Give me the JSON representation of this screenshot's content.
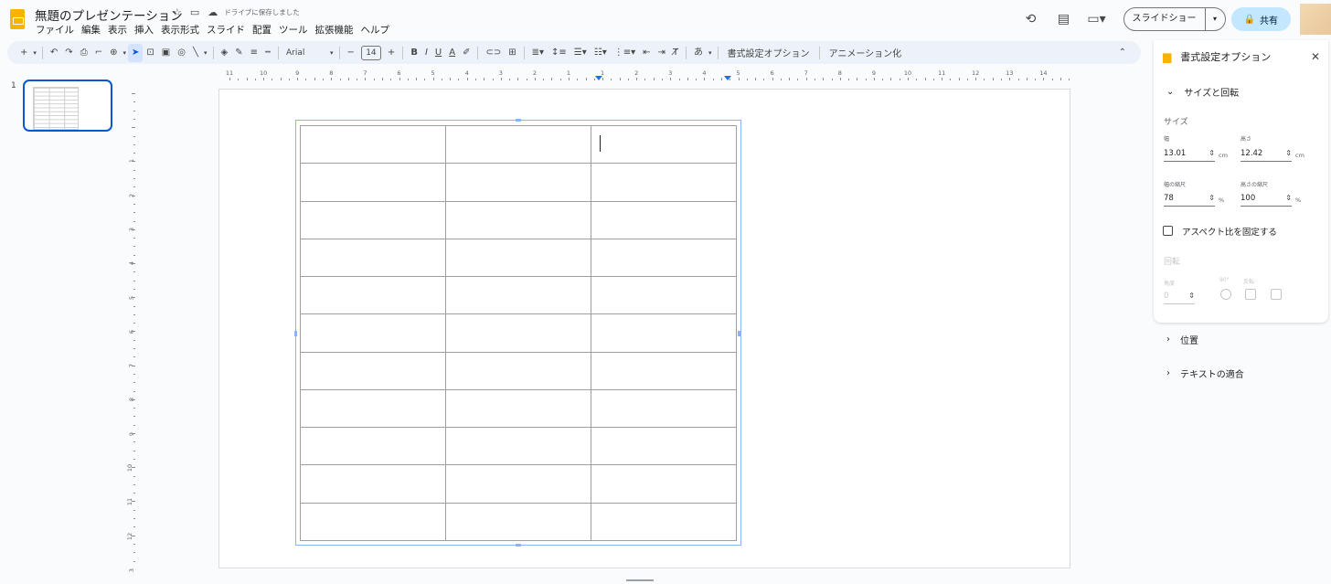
{
  "app": {
    "doc_title": "無題のプレゼンテーション",
    "saved_status": "ドライブに保存しました"
  },
  "menu": [
    "ファイル",
    "編集",
    "表示",
    "挿入",
    "表示形式",
    "スライド",
    "配置",
    "ツール",
    "拡張機能",
    "ヘルプ"
  ],
  "header": {
    "slideshow_label": "スライドショー",
    "share_label": "共有"
  },
  "toolbar": {
    "font_name": "Arial",
    "font_size": "14",
    "bold": "B",
    "italic": "I",
    "underline": "U",
    "text_color": "A",
    "format_options_label": "書式設定オプション",
    "animation_label": "アニメーション化",
    "text_style": "あ"
  },
  "ruler": {
    "top_labels": [
      "11",
      "10",
      "9",
      "8",
      "7",
      "6",
      "5",
      "4",
      "3",
      "2",
      "1",
      "1",
      "2",
      "3",
      "4",
      "5",
      "6",
      "7",
      "8",
      "9",
      "10",
      "11",
      "12",
      "13",
      "14"
    ],
    "left_labels": [
      "1",
      "2",
      "3",
      "4",
      "5",
      "6",
      "7",
      "8",
      "9",
      "10",
      "11",
      "12",
      "3"
    ]
  },
  "filmstrip": {
    "slide_number": "1"
  },
  "table": {
    "rows": 11,
    "cols": 3
  },
  "panel": {
    "title": "書式設定オプション",
    "size_section": "サイズと回転",
    "size_label": "サイズ",
    "width_label": "幅",
    "height_label": "高さ",
    "width_value": "13.01",
    "height_value": "12.42",
    "unit_cm": "cm",
    "width_scale_label": "幅の縮尺",
    "height_scale_label": "高さの縮尺",
    "width_scale_value": "78",
    "height_scale_value": "100",
    "unit_pct": "%",
    "lock_aspect_label": "アスペクト比を固定する",
    "rotation_label": "回転",
    "angle_label": "角度",
    "angle_value": "0",
    "rotate90_label": "90°",
    "flip_label": "反転",
    "position_section": "位置",
    "text_fit_section": "テキストの適合"
  },
  "colors": {
    "accent": "#0b57d0",
    "share_bg": "#c2e7ff",
    "toolbar_bg": "#edf2fa",
    "logo": "#f6b400"
  }
}
